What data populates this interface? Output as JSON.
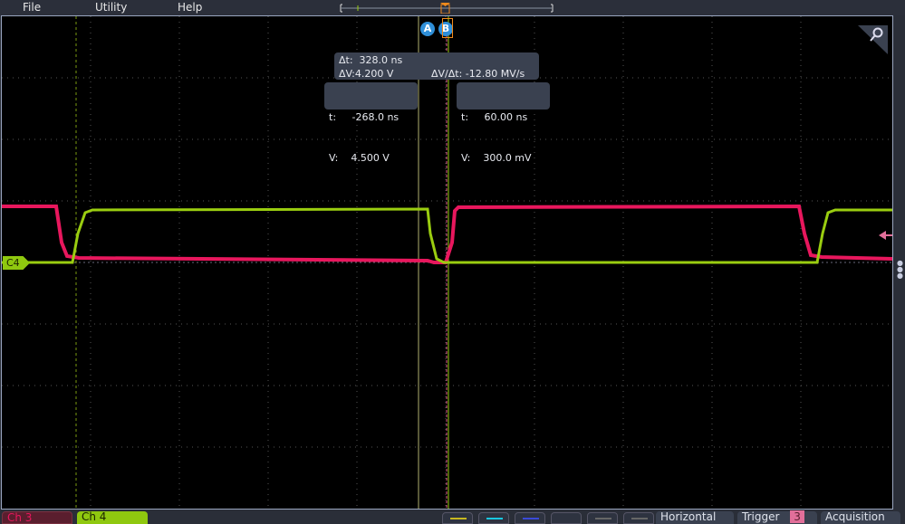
{
  "menu": {
    "items": [
      "File",
      "Utility",
      "Help"
    ]
  },
  "cursors": {
    "a_label": "A",
    "b_label": "B"
  },
  "delta_readout": {
    "dt": "Δt:  328.0 ns",
    "dv": "ΔV:4.200 V",
    "dvdt": "ΔV/Δt: -12.80 MV/s"
  },
  "cursor_a_readout": {
    "t": "t:     -268.0 ns",
    "v": "V:    4.500 V"
  },
  "cursor_b_readout": {
    "t": "t:     60.00 ns",
    "v": "V:    300.0 mV"
  },
  "channel_marker": "C4",
  "bottom": {
    "ch3": "Ch 3",
    "ch4": "Ch 4",
    "horizontal": "Horizontal",
    "trigger": "Trigger",
    "trigger_source": "3",
    "acquisition": "Acquisition"
  },
  "colors": {
    "ch3": "#e8175d",
    "ch4": "#9acd10",
    "cursor": "#2f8fd8",
    "trigger": "#f08a1c"
  }
}
